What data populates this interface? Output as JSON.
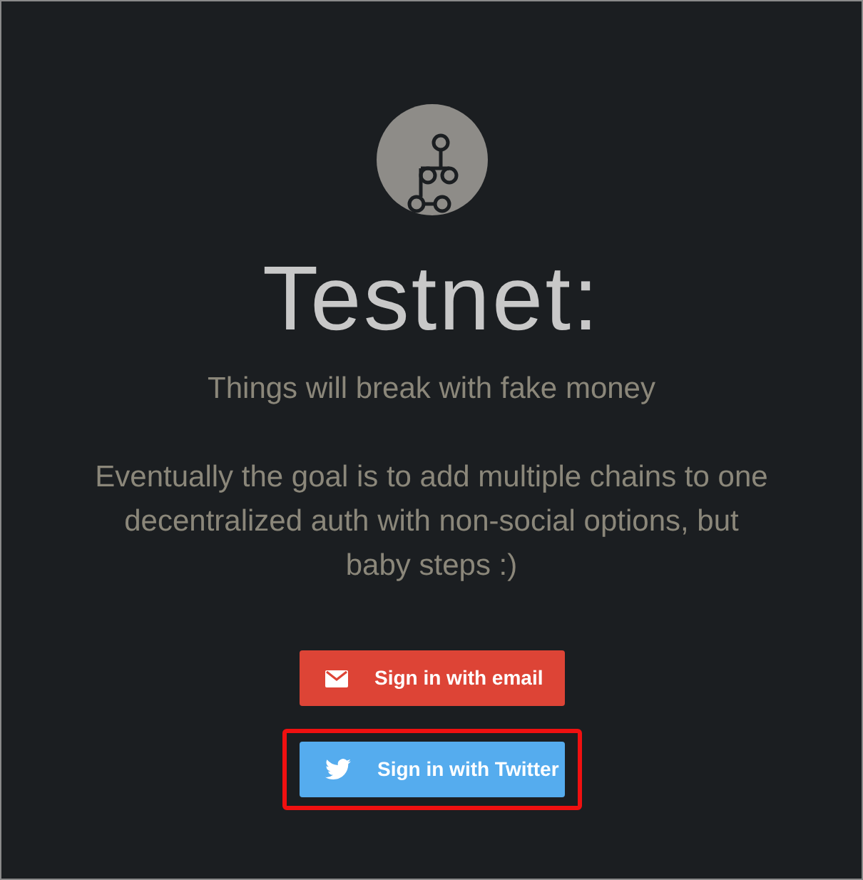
{
  "title": "Testnet:",
  "subtitle": "Things will break with fake money",
  "description": "Eventually the goal is to add multiple chains to one decentralized auth with non-social options, but baby steps :)",
  "buttons": [
    {
      "kind": "email",
      "label": "Sign in with email",
      "highlighted": false
    },
    {
      "kind": "twitter",
      "label": "Sign in with Twitter",
      "highlighted": true
    }
  ]
}
